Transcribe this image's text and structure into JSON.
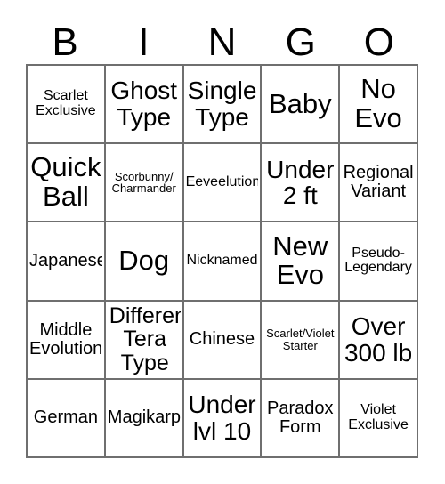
{
  "card": {
    "title": "BINGO",
    "header_letters": [
      "B",
      "I",
      "N",
      "G",
      "O"
    ],
    "grid_size": "5x5",
    "border_color": "#6f6f6f",
    "background_color": "#ffffff",
    "text_color": "#000000",
    "cells": [
      [
        {
          "text": "Scarlet\nExclusive",
          "size": "sm"
        },
        {
          "text": "Ghost\nType",
          "size": "xl"
        },
        {
          "text": "Single\nType",
          "size": "xl"
        },
        {
          "text": "Baby",
          "size": "xxl"
        },
        {
          "text": "No\nEvo",
          "size": "xxl"
        }
      ],
      [
        {
          "text": "Quick\nBall",
          "size": "xxl"
        },
        {
          "text": "Scorbunny/\nCharmander",
          "size": "xs"
        },
        {
          "text": "Eeveelution",
          "size": "sm"
        },
        {
          "text": "Under\n2 ft",
          "size": "xl"
        },
        {
          "text": "Regional\nVariant",
          "size": "md"
        }
      ],
      [
        {
          "text": "Japanese",
          "size": "md"
        },
        {
          "text": "Dog",
          "size": "xxl"
        },
        {
          "text": "Nicknamed",
          "size": "sm"
        },
        {
          "text": "New\nEvo",
          "size": "xxl"
        },
        {
          "text": "Pseudo-\nLegendary",
          "size": "sm"
        }
      ],
      [
        {
          "text": "Middle\nEvolution",
          "size": "md"
        },
        {
          "text": "Different\nTera\nType",
          "size": "lg"
        },
        {
          "text": "Chinese",
          "size": "md"
        },
        {
          "text": "Scarlet/Violet\nStarter",
          "size": "xs"
        },
        {
          "text": "Over\n300 lb",
          "size": "xl"
        }
      ],
      [
        {
          "text": "German",
          "size": "md"
        },
        {
          "text": "Magikarp",
          "size": "md"
        },
        {
          "text": "Under\nlvl 10",
          "size": "xl"
        },
        {
          "text": "Paradox\nForm",
          "size": "md"
        },
        {
          "text": "Violet\nExclusive",
          "size": "sm"
        }
      ]
    ]
  }
}
